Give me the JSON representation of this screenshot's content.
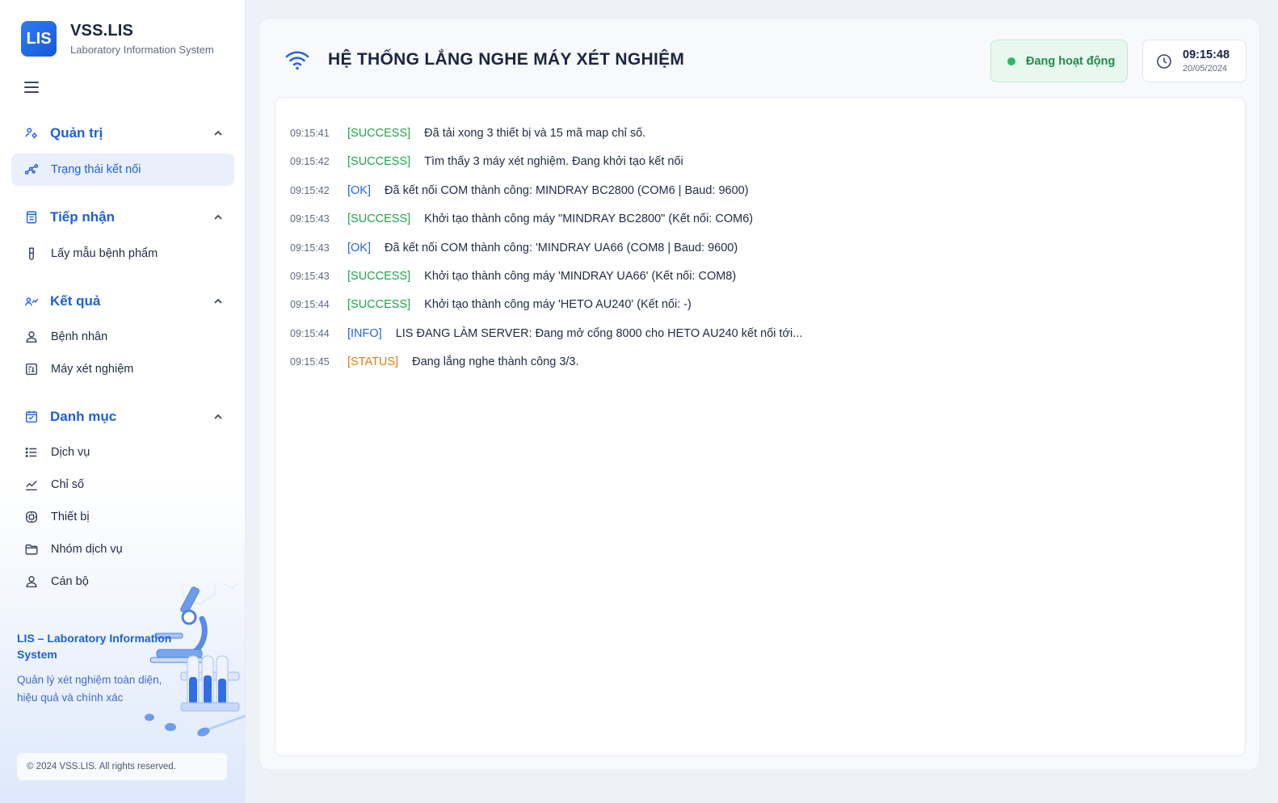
{
  "brand": {
    "logo_text": "LIS",
    "title": "VSS.LIS",
    "subtitle": "Laboratory Information System"
  },
  "sidebar": {
    "groups": [
      {
        "label": "Quản trị",
        "icon": "admin-icon",
        "items": [
          {
            "label": "Trạng thái kết nối",
            "icon": "connection-icon",
            "active": true
          }
        ]
      },
      {
        "label": "Tiếp nhận",
        "icon": "reception-icon",
        "items": [
          {
            "label": "Lấy mẫu bệnh phẩm",
            "icon": "test-tube-icon"
          }
        ]
      },
      {
        "label": "Kết quả",
        "icon": "results-icon",
        "items": [
          {
            "label": "Bệnh nhân",
            "icon": "user-icon"
          },
          {
            "label": "Máy xét nghiệm",
            "icon": "machine-icon"
          }
        ]
      },
      {
        "label": "Danh mục",
        "icon": "catalog-icon",
        "items": [
          {
            "label": "Dịch vụ",
            "icon": "list-icon"
          },
          {
            "label": "Chỉ số",
            "icon": "chart-line-icon"
          },
          {
            "label": "Thiết bị",
            "icon": "device-icon"
          },
          {
            "label": "Nhóm dịch vụ",
            "icon": "folder-icon"
          },
          {
            "label": "Cán bộ",
            "icon": "staff-icon"
          }
        ]
      }
    ],
    "promo": {
      "title": "LIS – Laboratory Information System",
      "description": "Quản lý xét nghiệm toàn diện, hiệu quả và chính xác"
    },
    "copyright": "© 2024 VSS.LIS. All rights reserved."
  },
  "header": {
    "title": "HỆ THỐNG LẮNG NGHE MÁY XÉT NGHIỆM",
    "status": "Đang hoạt động",
    "time": "09:15:48",
    "date": "20/05/2024"
  },
  "colors": {
    "accent": "#2563eb",
    "success": "#22a34a",
    "status": "#e07b12"
  },
  "logs": [
    {
      "time": "09:15:41",
      "tag": "[SUCCESS]",
      "type": "success",
      "message": "Đã tải xong 3 thiết bị và 15 mã map chỉ số."
    },
    {
      "time": "09:15:42",
      "tag": "[SUCCESS]",
      "type": "success",
      "message": "Tìm thấy 3 máy xét nghiệm. Đang khởi tạo kết nối"
    },
    {
      "time": "09:15:42",
      "tag": "[OK]",
      "type": "ok",
      "message": "Đã kết nối COM thành công: MINDRAY BC2800 (COM6 | Baud: 9600)"
    },
    {
      "time": "09:15:43",
      "tag": "[SUCCESS]",
      "type": "success",
      "message": "Khởi tạo thành công máy \"MINDRAY BC2800\" (Kết nối: COM6)"
    },
    {
      "time": "09:15:43",
      "tag": "[OK]",
      "type": "ok",
      "message": "Đã kết nối COM thành công: 'MINDRAY UA66 (COM8 | Baud: 9600)"
    },
    {
      "time": "09:15:43",
      "tag": "[SUCCESS]",
      "type": "success",
      "message": "Khởi tạo thành công máy 'MINDRAY UA66' (Kết nối: COM8)"
    },
    {
      "time": "09:15:44",
      "tag": "[SUCCESS]",
      "type": "success",
      "message": "Khởi tạo thành công máy 'HETO AU240' (Kết nối: -)"
    },
    {
      "time": "09:15:44",
      "tag": "[INFO]",
      "type": "info",
      "message": "LIS ĐANG LÀM SERVER: Đang mở cổng 8000 cho HETO AU240 kết nối tới..."
    },
    {
      "time": "09:15:45",
      "tag": "[STATUS]",
      "type": "status",
      "message": "Đang lắng nghe thành công 3/3."
    }
  ]
}
